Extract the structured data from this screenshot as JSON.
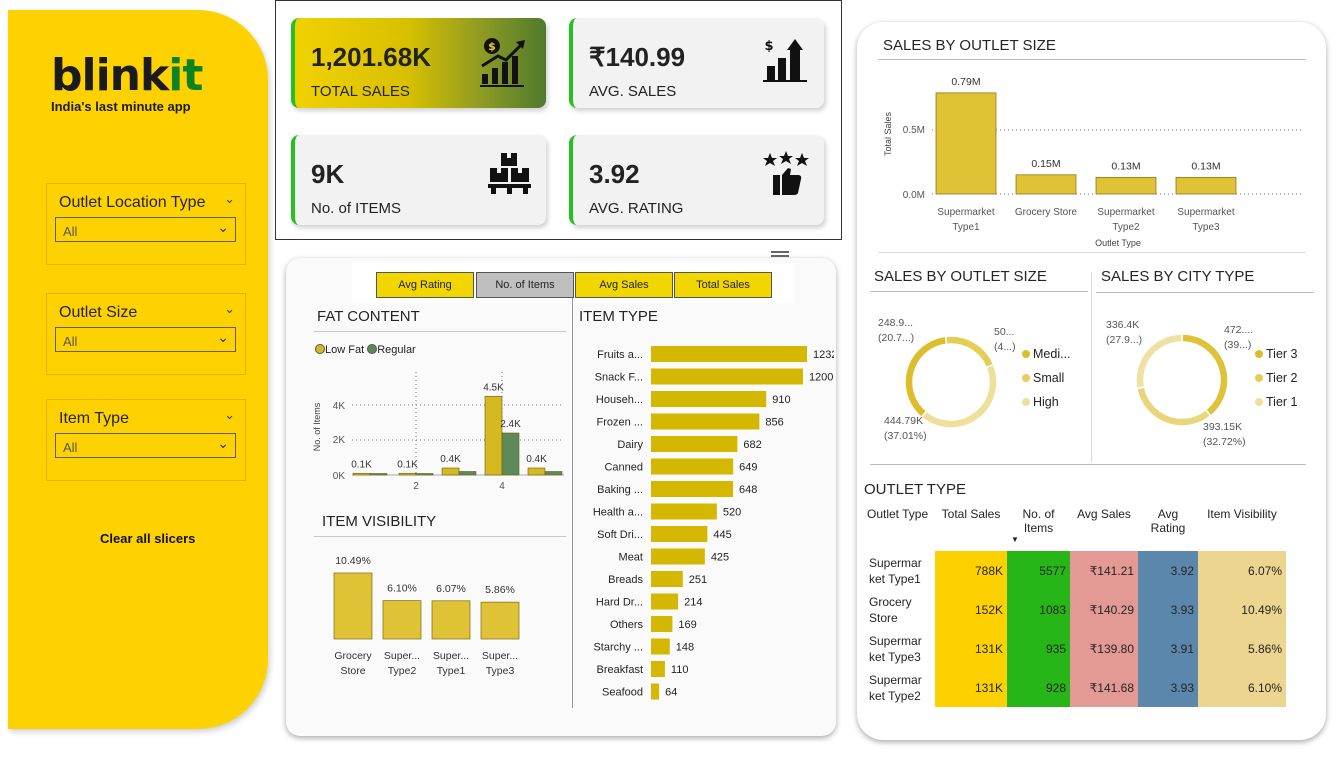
{
  "brand": {
    "name_prefix": "blink",
    "name_suffix": "it",
    "tagline": "India's last minute app"
  },
  "slicers": [
    {
      "label": "Outlet Location Type",
      "value": "All"
    },
    {
      "label": "Outlet Size",
      "value": "All"
    },
    {
      "label": "Item Type",
      "value": "All"
    }
  ],
  "clear_label": "Clear all slicers",
  "kpis": [
    {
      "value": "1,201.68K",
      "label": "TOTAL SALES",
      "icon": "sales-growth-icon"
    },
    {
      "value": "₹140.99",
      "label": "AVG. SALES",
      "icon": "rupee-bar-icon"
    },
    {
      "value": "9K",
      "label": "No. of ITEMS",
      "icon": "boxes-icon"
    },
    {
      "value": "3.92",
      "label": "AVG. RATING",
      "icon": "stars-thumb-icon"
    }
  ],
  "tabs": [
    "Avg Rating",
    "No. of Items",
    "Avg Sales",
    "Total Sales"
  ],
  "fat_content": {
    "title": "FAT CONTENT",
    "legend": [
      "Low Fat",
      "Regular"
    ],
    "ylabel": "No. of Items",
    "yticks": [
      "0K",
      "2K",
      "4K"
    ],
    "xticks": [
      "2",
      "4"
    ],
    "colors": {
      "low_fat": "#d4b921",
      "regular": "#5e8a5a"
    }
  },
  "item_visibility": {
    "title": "ITEM VISIBILITY",
    "bars": [
      {
        "label1": "Grocery",
        "label2": "Store",
        "value": 10.49,
        "text": "10.49%"
      },
      {
        "label1": "Super...",
        "label2": "Type2",
        "value": 6.1,
        "text": "6.10%"
      },
      {
        "label1": "Super...",
        "label2": "Type1",
        "value": 6.07,
        "text": "6.07%"
      },
      {
        "label1": "Super...",
        "label2": "Type3",
        "value": 5.86,
        "text": "5.86%"
      }
    ]
  },
  "item_type": {
    "title": "ITEM TYPE",
    "rows": [
      {
        "name": "Fruits a...",
        "value": 1232
      },
      {
        "name": "Snack F...",
        "value": 1200
      },
      {
        "name": "Househ...",
        "value": 910
      },
      {
        "name": "Frozen ...",
        "value": 856
      },
      {
        "name": "Dairy",
        "value": 682
      },
      {
        "name": "Canned",
        "value": 649
      },
      {
        "name": "Baking ...",
        "value": 648
      },
      {
        "name": "Health a...",
        "value": 520
      },
      {
        "name": "Soft Dri...",
        "value": 445
      },
      {
        "name": "Meat",
        "value": 425
      },
      {
        "name": "Breads",
        "value": 251
      },
      {
        "name": "Hard Dr...",
        "value": 214
      },
      {
        "name": "Others",
        "value": 169
      },
      {
        "name": "Starchy ...",
        "value": 148
      },
      {
        "name": "Breakfast",
        "value": 110
      },
      {
        "name": "Seafood",
        "value": 64
      }
    ],
    "bar_color": "#d4b700"
  },
  "sales_by_outlet_size_bar": {
    "title": "SALES BY OUTLET SIZE",
    "ylabel": "Total Sales",
    "xlabel": "Outlet Type",
    "yticks": [
      "0.0M",
      "0.5M"
    ]
  },
  "sales_by_outlet_size_donut": {
    "title": "SALES BY OUTLET SIZE",
    "labels": [
      "248.9...",
      "(20.7...)",
      "50...",
      "(4...)",
      "444.79K",
      "(37.01%)"
    ],
    "legend": [
      "Medi...",
      "Small",
      "High"
    ]
  },
  "sales_by_city_type": {
    "title": "SALES BY CITY TYPE",
    "labels": [
      "336.4K",
      "(27.9...)",
      "472....",
      "(39...)",
      "393.15K",
      "(32.72%)"
    ],
    "legend": [
      "Tier 3",
      "Tier 2",
      "Tier 1"
    ]
  },
  "outlet_type_table": {
    "title": "OUTLET TYPE",
    "headers": [
      "Outlet Type",
      "Total Sales",
      "No. of Items",
      "Avg Sales",
      "Avg Rating",
      "Item Visibility"
    ],
    "rows": [
      {
        "t1": "Supermar",
        "t2": "ket Type1",
        "sales": "788K",
        "items": "5577",
        "avg": "₹141.21",
        "rating": "3.92",
        "vis": "6.07%"
      },
      {
        "t1": "Grocery",
        "t2": "Store",
        "sales": "152K",
        "items": "1083",
        "avg": "₹140.29",
        "rating": "3.93",
        "vis": "10.49%"
      },
      {
        "t1": "Supermar",
        "t2": "ket Type3",
        "sales": "131K",
        "items": "935",
        "avg": "₹139.80",
        "rating": "3.91",
        "vis": "5.86%"
      },
      {
        "t1": "Supermar",
        "t2": "ket Type2",
        "sales": "131K",
        "items": "928",
        "avg": "₹141.68",
        "rating": "3.93",
        "vis": "6.10%"
      }
    ],
    "colors": {
      "sales": "#fdd000",
      "items": "#27b618",
      "avg": "#e39a95",
      "rating": "#5b87ad",
      "vis": "#ecd58f"
    }
  },
  "chart_data": [
    {
      "type": "bar",
      "title": "SALES BY OUTLET SIZE",
      "categories": [
        "Supermarket Type1",
        "Grocery Store",
        "Supermarket Type2",
        "Supermarket Type3"
      ],
      "values": [
        0.79,
        0.15,
        0.13,
        0.13
      ],
      "labels": [
        "0.79M",
        "0.15M",
        "0.13M",
        "0.13M"
      ],
      "xlabel": "Outlet Type",
      "ylabel": "Total Sales",
      "ylim": [
        0,
        0.8
      ],
      "color": "#dfc235"
    },
    {
      "type": "bar",
      "title": "FAT CONTENT",
      "x": [
        1,
        2,
        3,
        4,
        5
      ],
      "series": [
        {
          "name": "Low Fat",
          "values": [
            0.1,
            0.1,
            0.4,
            4.5,
            0.4
          ],
          "labels": [
            "0.1K",
            "0.1K",
            "0.4K",
            "4.5K",
            "0.4K"
          ]
        },
        {
          "name": "Regular",
          "values": [
            0.05,
            0.05,
            0.2,
            2.4,
            0.2
          ],
          "labels": [
            "",
            "",
            "",
            "2.4K",
            ""
          ]
        }
      ],
      "ylabel": "No. of Items",
      "ylim": [
        0,
        5
      ]
    },
    {
      "type": "pie",
      "title": "SALES BY OUTLET SIZE",
      "slices": [
        {
          "name": "Medi...",
          "value": 444.79,
          "share": 37.01
        },
        {
          "name": "Small",
          "value": 248.9,
          "share": 20.7
        },
        {
          "name": "High",
          "value": 508,
          "share": 42.29
        }
      ]
    },
    {
      "type": "pie",
      "title": "SALES BY CITY TYPE",
      "slices": [
        {
          "name": "Tier 3",
          "value": 472,
          "share": 39.3
        },
        {
          "name": "Tier 2",
          "value": 393.15,
          "share": 32.72
        },
        {
          "name": "Tier 1",
          "value": 336.4,
          "share": 27.98
        }
      ]
    }
  ]
}
